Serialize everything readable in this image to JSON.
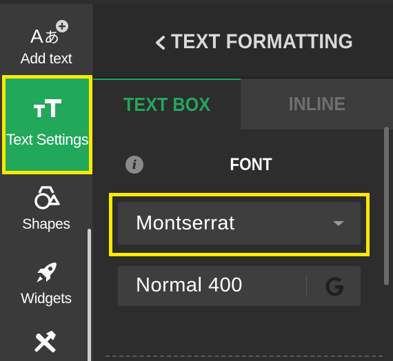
{
  "sidebar": {
    "items": [
      {
        "label": "Add text",
        "icon": "add-text-icon"
      },
      {
        "label": "Text Settings",
        "icon": "text-settings-icon"
      },
      {
        "label": "Shapes",
        "icon": "shapes-icon"
      },
      {
        "label": "Widgets",
        "icon": "rocket-icon"
      },
      {
        "label": "",
        "icon": "tools-icon"
      }
    ]
  },
  "panel": {
    "title": "TEXT FORMATTING",
    "tabs": [
      {
        "label": "TEXT BOX",
        "active": true
      },
      {
        "label": "INLINE",
        "active": false
      }
    ],
    "section": {
      "title": "FONT",
      "font_family": "Montserrat",
      "font_weight": "Normal 400"
    }
  },
  "colors": {
    "accent_green": "#22a85a",
    "highlight_yellow": "#ffea00",
    "panel_bg": "#2d2d2d",
    "sidebar_bg": "#3a3a3a"
  }
}
